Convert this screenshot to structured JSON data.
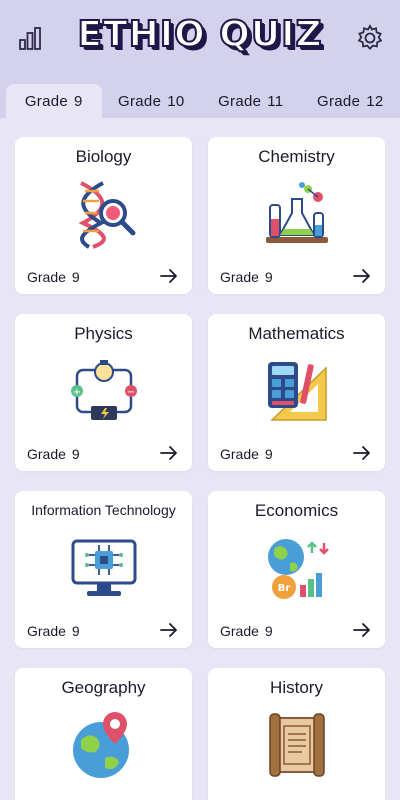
{
  "app": {
    "title": "ETHIO QUIZ",
    "icons": {
      "stats": "bar-chart-icon",
      "settings": "gear-icon"
    }
  },
  "tabs": [
    {
      "label": "Grade",
      "num": "9",
      "active": true
    },
    {
      "label": "Grade",
      "num": "10",
      "active": false
    },
    {
      "label": "Grade",
      "num": "11",
      "active": false
    },
    {
      "label": "Grade",
      "num": "12",
      "active": false
    }
  ],
  "subjects": [
    {
      "title": "Biology",
      "grade_label": "Grade",
      "grade_num": "9",
      "icon": "dna-magnifier-icon"
    },
    {
      "title": "Chemistry",
      "grade_label": "Grade",
      "grade_num": "9",
      "icon": "flasks-icon"
    },
    {
      "title": "Physics",
      "grade_label": "Grade",
      "grade_num": "9",
      "icon": "circuit-bulb-icon"
    },
    {
      "title": "Mathematics",
      "grade_label": "Grade",
      "grade_num": "9",
      "icon": "calculator-ruler-icon"
    },
    {
      "title": "Information Technology",
      "grade_label": "Grade",
      "grade_num": "9",
      "icon": "computer-chip-icon"
    },
    {
      "title": "Economics",
      "grade_label": "Grade",
      "grade_num": "9",
      "icon": "globe-money-chart-icon"
    },
    {
      "title": "Geography",
      "grade_label": "",
      "grade_num": "",
      "icon": "globe-pin-icon"
    },
    {
      "title": "History",
      "grade_label": "",
      "grade_num": "",
      "icon": "scroll-icon"
    }
  ],
  "colors": {
    "background": "#d4d1ec",
    "panel": "#e8e6f5",
    "card": "#ffffff",
    "title_outline": "#1e1748",
    "text": "#1b1b2b"
  }
}
